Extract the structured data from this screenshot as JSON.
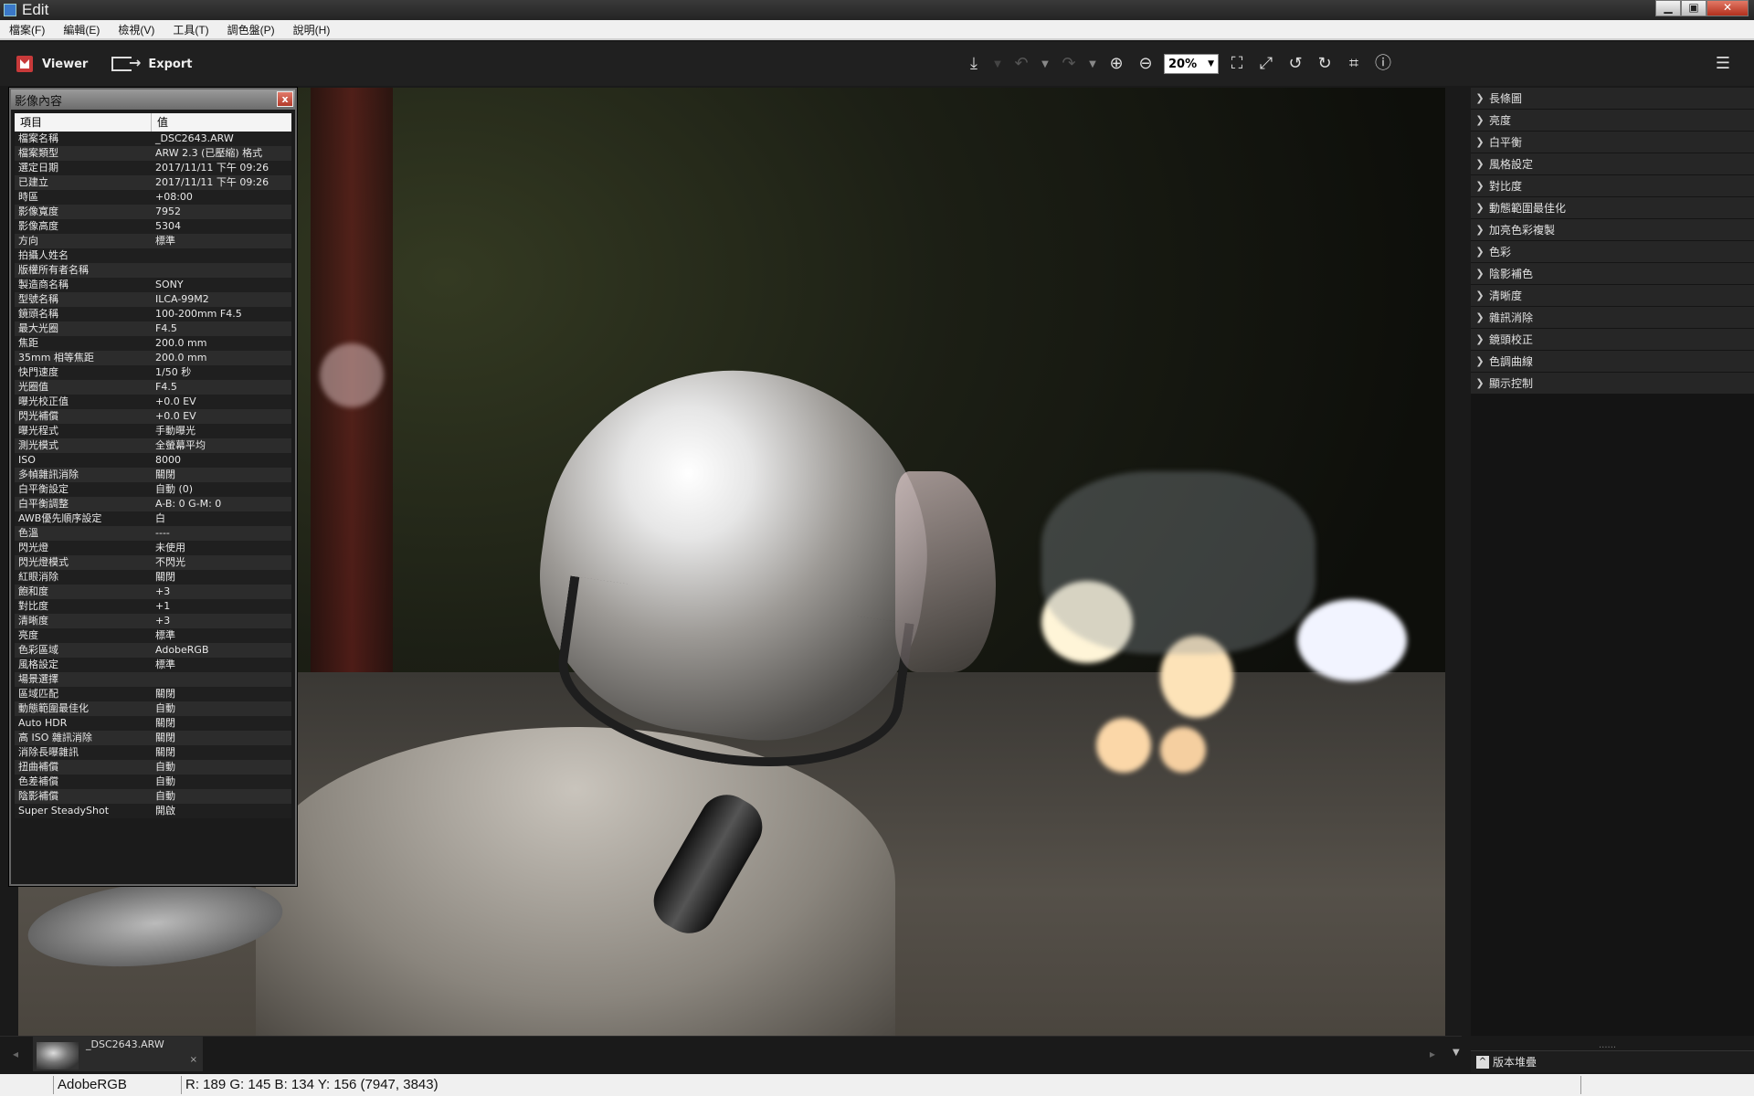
{
  "window": {
    "title": "Edit",
    "min": "▁",
    "max": "▣",
    "close": "✕"
  },
  "menu": [
    "檔案(F)",
    "編輯(E)",
    "檢視(V)",
    "工具(T)",
    "調色盤(P)",
    "說明(H)"
  ],
  "toolbar": {
    "viewer_label": "Viewer",
    "export_label": "Export",
    "zoom_value": "20%",
    "icons": {
      "save": "⤓",
      "undo": "↶",
      "redo": "↷",
      "zoom_in": "⊕",
      "zoom_out": "⊖",
      "fit": "⛶",
      "actual": "⤢",
      "rotate_left": "↺",
      "rotate_right": "↻",
      "crop": "⌗",
      "info": "ⓘ",
      "settings": "☰"
    }
  },
  "props": {
    "title": "影像內容",
    "close": "x",
    "col_key": "項目",
    "col_val": "值",
    "rows": [
      [
        "檔案名稱",
        "_DSC2643.ARW"
      ],
      [
        "檔案類型",
        "ARW 2.3 (已壓縮) 格式"
      ],
      [
        "選定日期",
        "2017/11/11 下午 09:26"
      ],
      [
        "已建立",
        "2017/11/11 下午 09:26"
      ],
      [
        "時區",
        "+08:00"
      ],
      [
        "影像寬度",
        "7952"
      ],
      [
        "影像高度",
        "5304"
      ],
      [
        "方向",
        "標準"
      ],
      [
        "拍攝人姓名",
        ""
      ],
      [
        "版權所有者名稱",
        ""
      ],
      [
        "製造商名稱",
        "SONY"
      ],
      [
        "型號名稱",
        "ILCA-99M2"
      ],
      [
        "鏡頭名稱",
        "100-200mm F4.5"
      ],
      [
        "最大光圈",
        "F4.5"
      ],
      [
        "焦距",
        "200.0 mm"
      ],
      [
        "35mm 相等焦距",
        "200.0 mm"
      ],
      [
        "快門速度",
        "1/50 秒"
      ],
      [
        "光圈值",
        "F4.5"
      ],
      [
        "曝光校正值",
        "+0.0 EV"
      ],
      [
        "閃光補償",
        "+0.0 EV"
      ],
      [
        "曝光程式",
        "手動曝光"
      ],
      [
        "測光模式",
        "全螢幕平均"
      ],
      [
        "ISO",
        "8000"
      ],
      [
        "多幀雜訊消除",
        "關閉"
      ],
      [
        "白平衡設定",
        "自動 (0)"
      ],
      [
        "白平衡調整",
        "A-B: 0 G-M: 0"
      ],
      [
        "AWB優先順序設定",
        "白"
      ],
      [
        "色溫",
        "----"
      ],
      [
        "閃光燈",
        "未使用"
      ],
      [
        "閃光燈模式",
        "不閃光"
      ],
      [
        "紅眼消除",
        "關閉"
      ],
      [
        "飽和度",
        "+3"
      ],
      [
        "對比度",
        "+1"
      ],
      [
        "清晰度",
        "+3"
      ],
      [
        "亮度",
        "標準"
      ],
      [
        "色彩區域",
        "AdobeRGB"
      ],
      [
        "風格設定",
        "標準"
      ],
      [
        "場景選擇",
        ""
      ],
      [
        "區域匹配",
        "關閉"
      ],
      [
        "動態範圍最佳化",
        "自動"
      ],
      [
        "Auto HDR",
        "關閉"
      ],
      [
        "高 ISO 雜訊消除",
        "關閉"
      ],
      [
        "消除長曝雜訊",
        "關閉"
      ],
      [
        "扭曲補償",
        "自動"
      ],
      [
        "色差補償",
        "自動"
      ],
      [
        "陰影補償",
        "自動"
      ],
      [
        "Super SteadyShot",
        "開啟"
      ]
    ]
  },
  "adjustments": [
    "長條圖",
    "亮度",
    "白平衡",
    "風格設定",
    "對比度",
    "動態範圍最佳化",
    "加亮色彩複製",
    "色彩",
    "陰影補色",
    "清晰度",
    "雜訊消除",
    "鏡頭校正",
    "色調曲線",
    "顯示控制"
  ],
  "filmstrip": {
    "filename": "_DSC2643.ARW",
    "close": "×",
    "prev": "◂",
    "next": "▸",
    "down": "▼"
  },
  "stack": {
    "label": "版本堆疊",
    "icon": "^",
    "grip": "......"
  },
  "status": {
    "color_space": "AdobeRGB",
    "pixel_info": "R: 189  G: 145  B: 134  Y: 156    (7947, 3843)"
  }
}
